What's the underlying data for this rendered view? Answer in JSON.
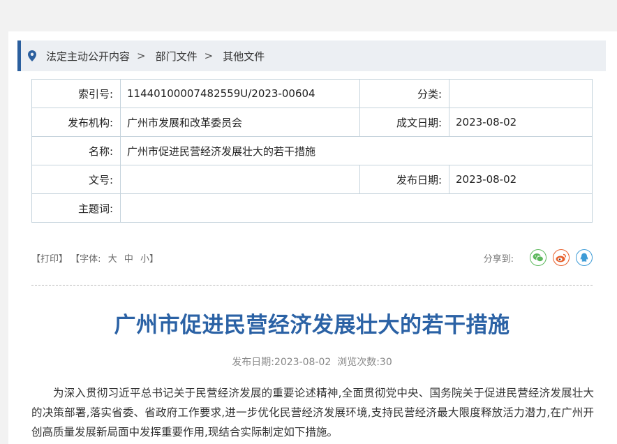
{
  "breadcrumb": {
    "items": [
      "法定主动公开内容",
      "部门文件",
      "其他文件"
    ],
    "separator": ">"
  },
  "meta": {
    "index_label": "索引号:",
    "index_value": "11440100007482559U/2023-00604",
    "category_label": "分类:",
    "category_value": "",
    "publisher_label": "发布机构:",
    "publisher_value": "广州市发展和改革委员会",
    "written_date_label": "成文日期:",
    "written_date_value": "2023-08-02",
    "name_label": "名称:",
    "name_value": "广州市促进民营经济发展壮大的若干措施",
    "doc_no_label": "文号:",
    "doc_no_value": "",
    "publish_date_label": "发布日期:",
    "publish_date_value": "2023-08-02",
    "keywords_label": "主题词:",
    "keywords_value": ""
  },
  "toolbar": {
    "print": "【打印】",
    "font_prefix": "【字体:",
    "font_large": "大",
    "font_medium": "中",
    "font_small": "小】",
    "share_label": "分享到:"
  },
  "share_icons": [
    "wechat-icon",
    "weibo-icon",
    "qq-icon"
  ],
  "colors": {
    "accent": "#2b5f9e",
    "title": "#2b62a5",
    "wechat": "#5bb85b",
    "weibo": "#e8602c",
    "qq": "#3d9bd6"
  },
  "article": {
    "title": "广州市促进民营经济发展壮大的若干措施",
    "info": "发布日期:2023-08-02  浏览次数:30",
    "paragraph": "为深入贯彻习近平总书记关于民营经济发展的重要论述精神,全面贯彻党中央、国务院关于促进民营经济发展壮大的决策部署,落实省委、省政府工作要求,进一步优化民营经济发展环境,支持民营经济最大限度释放活力潜力,在广州开创高质量发展新局面中发挥重要作用,现结合实际制定如下措施。"
  }
}
